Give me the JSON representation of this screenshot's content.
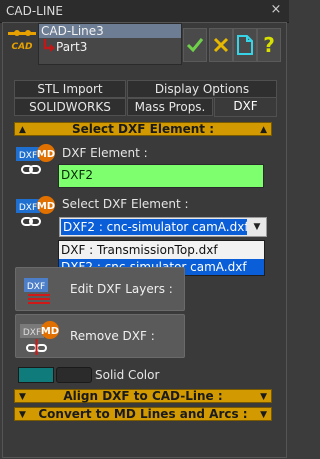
{
  "window": {
    "title": "CAD-LINE",
    "close_glyph": "×"
  },
  "tree": {
    "icon_label": "CAD",
    "items": [
      {
        "label": "CAD-Line3",
        "selected": true
      },
      {
        "label": "Part3",
        "selected": false
      }
    ]
  },
  "toolbar": {
    "check_icon": "check-icon",
    "cross_icon": "cross-icon",
    "file_icon": "new-file-icon",
    "help_label": "?"
  },
  "tabs": {
    "row1": [
      "STL Import",
      "Display Options"
    ],
    "row2": [
      "SOLIDWORKS",
      "Mass Props.",
      "DXF"
    ],
    "active": "DXF"
  },
  "select_section": {
    "title": "Select DXF Element :"
  },
  "dxf_element": {
    "label": "DXF Element :",
    "value": "DXF2"
  },
  "select_dxf_element": {
    "label": "Select DXF Element :",
    "selected": "DXF2 : cnc-simulator camA.dxf",
    "options": [
      "DXF : TransmissionTop.dxf",
      "DXF2 : cnc-simulator camA.dxf"
    ]
  },
  "buttons": {
    "edit_layers": "Edit DXF Layers :",
    "remove_dxf": "Remove DXF :"
  },
  "color": {
    "label": "Solid Color",
    "swatch": "#0f7b7b"
  },
  "align_section": {
    "title": "Align DXF to CAD-Line :"
  },
  "convert_section": {
    "title": "Convert to MD Lines and Arcs :"
  },
  "icons": {
    "dxf_tag": "DXF",
    "md_tag": "MD"
  },
  "colors": {
    "accent_gold": "#d29a00",
    "green_field": "#7dff6e",
    "selection_blue": "#0a5ed7"
  }
}
